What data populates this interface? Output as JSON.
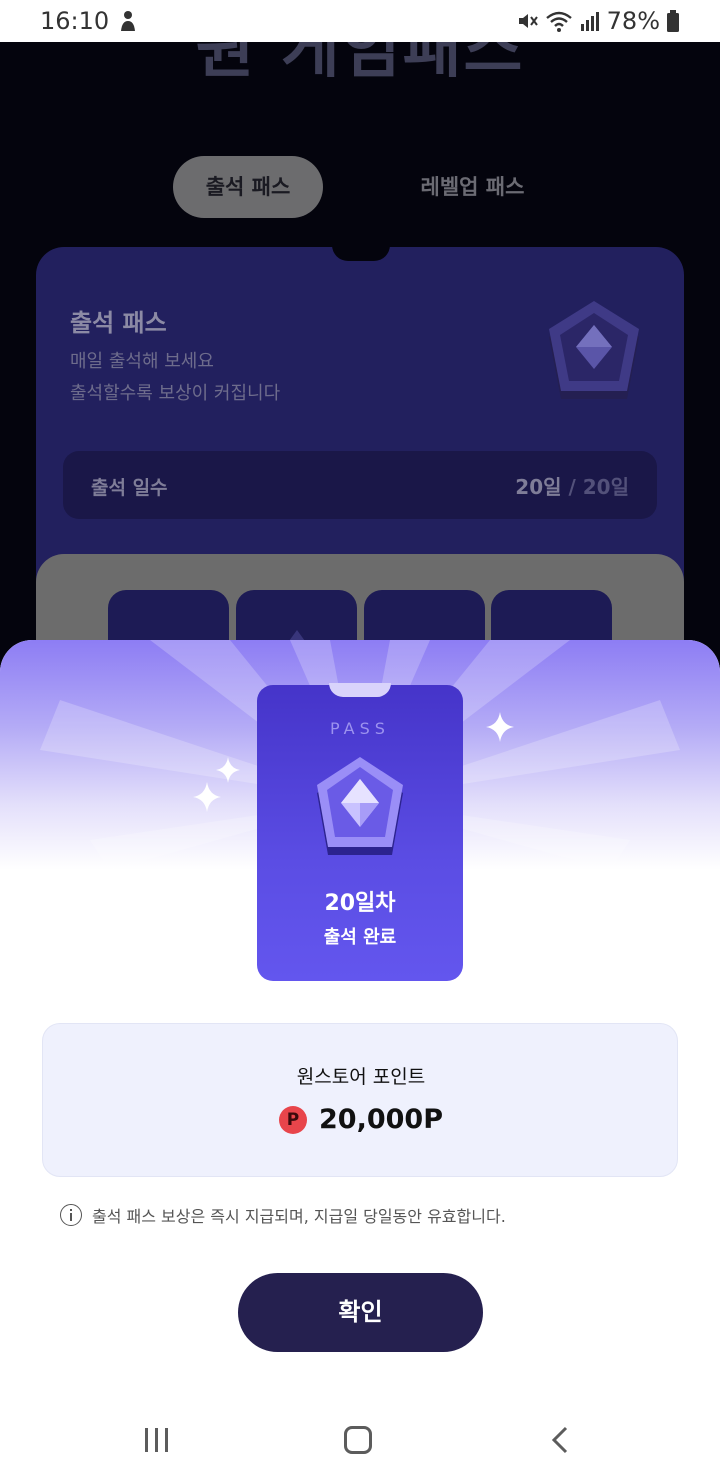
{
  "status_bar": {
    "time": "16:10",
    "battery": "78%",
    "icons": [
      "person-icon",
      "mute-icon",
      "wifi-icon",
      "signal-icon",
      "battery-icon"
    ]
  },
  "background": {
    "hero_title": "원 게임패스",
    "tabs": [
      {
        "label": "출석 패스",
        "active": true
      },
      {
        "label": "레벨업 패스",
        "active": false
      }
    ],
    "pass_card": {
      "title": "출석 패스",
      "subtitle_1": "매일 출석해 보세요",
      "subtitle_2": "출석할수록 보상이 커집니다",
      "days_label": "출석 일수",
      "days_current": "20일",
      "days_separator": " / ",
      "days_total": "20일"
    }
  },
  "sheet": {
    "card": {
      "badge": "PASS",
      "day": "20일차",
      "status": "출석 완료"
    },
    "reward": {
      "label": "원스토어 포인트",
      "point_icon": "P",
      "value": "20,000P"
    },
    "notice": "출석 패스 보상은 즉시 지급되며, 지급일 당일동안 유효합니다.",
    "confirm_label": "확인"
  },
  "nav": {
    "icons": [
      "recent-apps-icon",
      "home-icon",
      "back-icon"
    ]
  },
  "colors": {
    "accent": "#5b4de4",
    "button": "#25204f",
    "point_icon": "#e8454b",
    "point_box": "#eff1fd"
  }
}
